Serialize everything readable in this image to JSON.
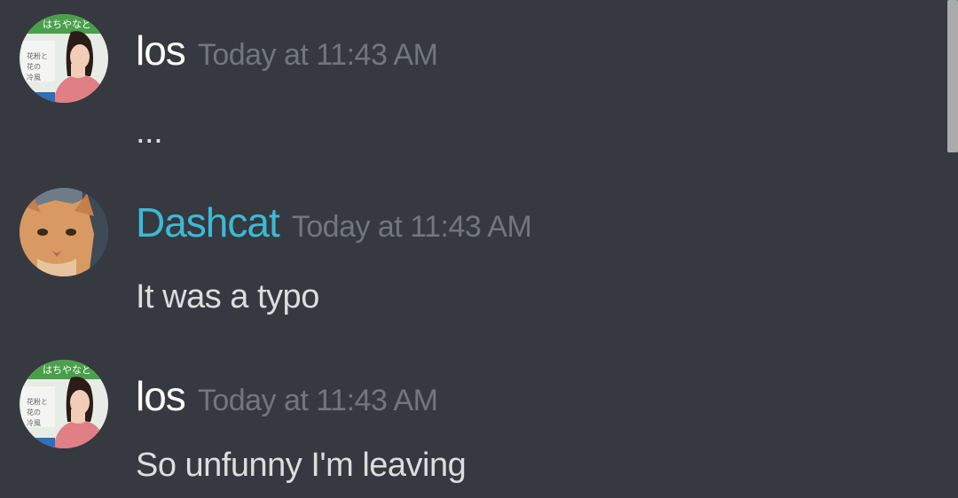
{
  "messages": [
    {
      "author": "los",
      "timestamp": "Today at 11:43 AM",
      "text": "...",
      "author_color": "#ffffff",
      "avatar": "woman-tv-avatar"
    },
    {
      "author": "Dashcat",
      "timestamp": "Today at 11:43 AM",
      "text": "It was a typo",
      "author_color": "#3bbad6",
      "avatar": "orange-cat-avatar"
    },
    {
      "author": "los",
      "timestamp": "Today at 11:43 AM",
      "text": "So unfunny I'm leaving",
      "author_color": "#ffffff",
      "avatar": "woman-tv-avatar"
    }
  ],
  "theme": {
    "background": "#36393f",
    "timestamp_color": "#72767d",
    "text_color": "#dcddde"
  }
}
